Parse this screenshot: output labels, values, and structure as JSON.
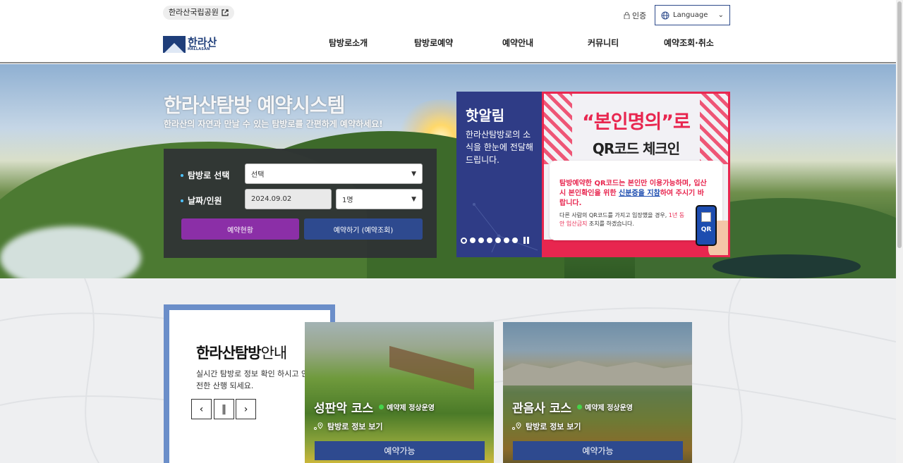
{
  "header": {
    "park_link": "한라산국립공원",
    "auth": "인증",
    "language": "Language",
    "logo_korean": "한라산",
    "logo_english": "HALLASAN",
    "nav": [
      {
        "label": "탐방로소개"
      },
      {
        "label": "탐방로예약"
      },
      {
        "label": "예약안내"
      },
      {
        "label": "커뮤니티"
      },
      {
        "label": "예약조회·취소"
      }
    ]
  },
  "hero": {
    "title": "한라산탐방 예약시스템",
    "subtitle": "한라산의 자연과 만날 수 있는 탐방로를 간편하게 예약하세요!",
    "form": {
      "trail_label": "탐방로 선택",
      "trail_value": "선택",
      "date_label": "날짜/인원",
      "date_value": "2024.09.02",
      "people_value": "1명",
      "status_button": "예약현황",
      "reserve_button": "예약하기 (예약조회)"
    }
  },
  "notice": {
    "title": "핫알림",
    "desc": "한라산탐방로의 소식을 한눈에 전달해 드립니다.",
    "slide_count": 7,
    "active_slide": 1,
    "banner": {
      "headline": "“본인명의”로",
      "subheadline": "QR코드 체크인",
      "red_text_1": "탐방예약한 QR코드는 본인만 이용가능하며, 입산시 본인확인을 위한 ",
      "red_text_highlight": "신분증을 지참",
      "red_text_2": "하여 주시기 바랍니다.",
      "black_text_1": "다른 사람의 QR코드를 가지고 입장했을 경우, ",
      "black_text_highlight": "1년 동안 입산금지",
      "black_text_2": " 조치를 하겠습니다.",
      "qr_label": "QR"
    }
  },
  "guide": {
    "title_bold": "한라산탐방",
    "title_rest": "안내",
    "desc": "실시간 탐방로 정보 확인 하시고 안전한 산행 되세요.",
    "prev": "‹",
    "pause": "‖",
    "next": "›"
  },
  "courses": [
    {
      "name": "성판악 코스",
      "status": "예약제 정상운영",
      "info": "탐방로 정보 보기",
      "button": "예약가능"
    },
    {
      "name": "관음사 코스",
      "status": "예약제 정상운영",
      "info": "탐방로 정보 보기",
      "button": "예약가능"
    }
  ],
  "colors": {
    "brand_blue": "#2e4a8f",
    "purple": "#8b2fa7",
    "alert_red": "#e8264f",
    "status_green": "#45d34a"
  }
}
